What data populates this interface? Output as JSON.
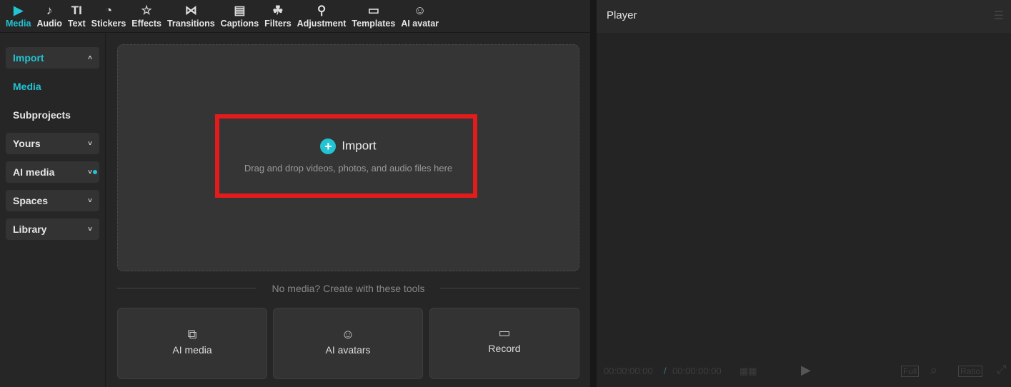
{
  "toolbar": [
    {
      "label": "Media",
      "icon": "media-icon"
    },
    {
      "label": "Audio",
      "icon": "audio-icon"
    },
    {
      "label": "Text",
      "icon": "text-icon"
    },
    {
      "label": "Stickers",
      "icon": "stickers-icon"
    },
    {
      "label": "Effects",
      "icon": "effects-icon"
    },
    {
      "label": "Transitions",
      "icon": "transitions-icon"
    },
    {
      "label": "Captions",
      "icon": "captions-icon"
    },
    {
      "label": "Filters",
      "icon": "filters-icon"
    },
    {
      "label": "Adjustment",
      "icon": "adjustment-icon"
    },
    {
      "label": "Templates",
      "icon": "templates-icon"
    },
    {
      "label": "AI avatar",
      "icon": "ai-avatar-icon"
    }
  ],
  "sidebar": {
    "import": "Import",
    "media": "Media",
    "subprojects": "Subprojects",
    "yours": "Yours",
    "ai_media": "AI media",
    "spaces": "Spaces",
    "library": "Library"
  },
  "main": {
    "import_label": "Import",
    "drop_hint": "Drag and drop videos, photos, and audio files here",
    "no_media": "No media? Create with these tools",
    "cards": [
      "AI media",
      "AI avatars",
      "Record"
    ]
  },
  "player": {
    "title": "Player",
    "current_time": "00:00:00:00",
    "separator": "/",
    "total_time": "00:00:00:00",
    "full": "Full",
    "ratio": "Ratio"
  },
  "colors": {
    "accent": "#22c3d2",
    "highlight": "#e31b1b"
  }
}
